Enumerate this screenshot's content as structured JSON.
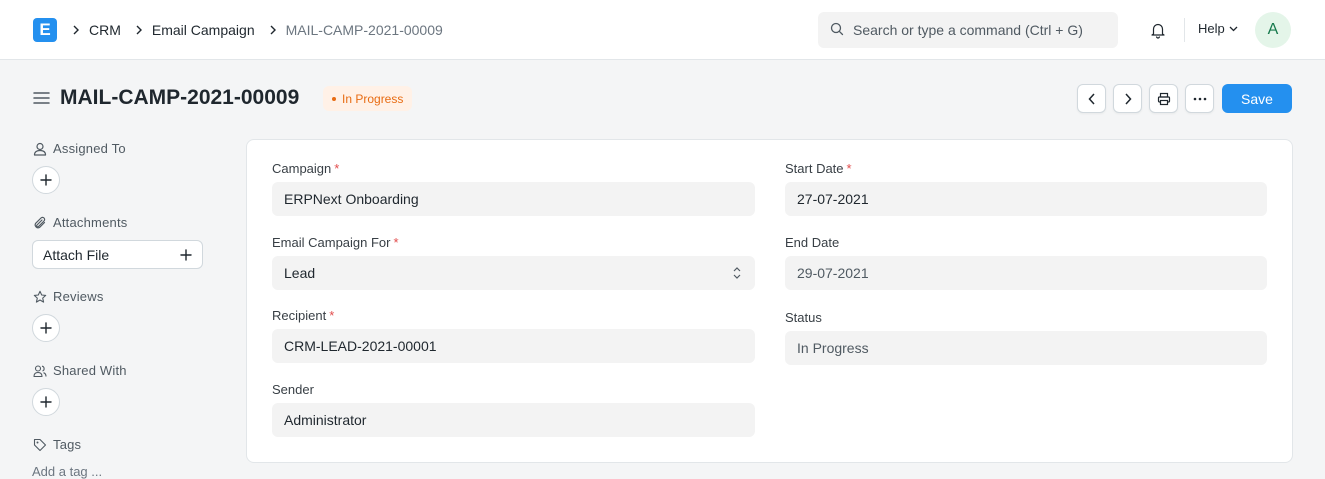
{
  "navbar": {
    "logo_letter": "E",
    "breadcrumbs": [
      "CRM",
      "Email Campaign",
      "MAIL-CAMP-2021-00009"
    ],
    "search_placeholder": "Search or type a command (Ctrl + G)",
    "help_label": "Help",
    "avatar_letter": "A"
  },
  "page": {
    "title": "MAIL-CAMP-2021-00009",
    "status": "In Progress",
    "save_label": "Save"
  },
  "sidebar": {
    "assigned_to": "Assigned To",
    "attachments": "Attachments",
    "attach_file": "Attach File",
    "reviews": "Reviews",
    "shared_with": "Shared With",
    "tags": "Tags",
    "add_tag": "Add a tag ..."
  },
  "form": {
    "campaign": {
      "label": "Campaign",
      "value": "ERPNext Onboarding"
    },
    "email_campaign_for": {
      "label": "Email Campaign For",
      "value": "Lead"
    },
    "recipient": {
      "label": "Recipient",
      "value": "CRM-LEAD-2021-00001"
    },
    "sender": {
      "label": "Sender",
      "value": "Administrator"
    },
    "start_date": {
      "label": "Start Date",
      "value": "27-07-2021"
    },
    "end_date": {
      "label": "End Date",
      "value": "29-07-2021"
    },
    "status": {
      "label": "Status",
      "value": "In Progress"
    }
  },
  "colors": {
    "primary": "#2490ef",
    "status_text": "#e86c13",
    "status_bg": "#fff1e7",
    "required": "#e24c4c"
  }
}
